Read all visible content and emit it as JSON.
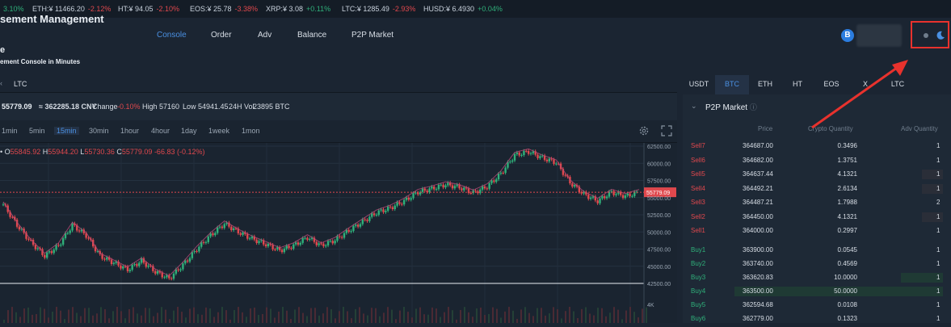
{
  "ticker": [
    {
      "name": "",
      "price": "",
      "change": "3.10%",
      "dir": "up"
    },
    {
      "name": "ETH:",
      "price": "¥ 11466.20",
      "change": "-2.12%",
      "dir": "down"
    },
    {
      "name": "HT:",
      "price": "¥ 94.05",
      "change": "-2.10%",
      "dir": "down"
    },
    {
      "name": "EOS:",
      "price": "¥ 25.78",
      "change": "-3.38%",
      "dir": "down"
    },
    {
      "name": "XRP:",
      "price": "¥ 3.08",
      "change": "+0.11%",
      "dir": "up"
    },
    {
      "name": "LTC:",
      "price": "¥ 1285.49",
      "change": "-2.93%",
      "dir": "down"
    },
    {
      "name": "HUSD:",
      "price": "¥ 6.4930",
      "change": "+0.04%",
      "dir": "up"
    }
  ],
  "header": {
    "title": "sement Management",
    "nav": [
      "Console",
      "Order",
      "Adv",
      "Balance",
      "P2P Market"
    ],
    "avatar": "B",
    "subtitle": "e",
    "subtext": "ement Console in Minutes"
  },
  "colors": {
    "accent": "#4a90e2",
    "up": "#2fb07a",
    "down": "#e0484d",
    "highlight": "#e8322d"
  },
  "left": {
    "coin": "LTC",
    "price": "55779.09",
    "cny": "≈ 362285.18 CNY",
    "change_label": "Change",
    "change_value": "-0.10%",
    "high_label": "High",
    "high_value": "57160",
    "low_label": "Low",
    "low_value": "54941.45",
    "vol_label": "24H Vol.",
    "vol_value": "23895 BTC",
    "intervals": [
      "1min",
      "5min",
      "15min",
      "30min",
      "1hour",
      "4hour",
      "1day",
      "1week",
      "1mon"
    ],
    "active_interval": "15min"
  },
  "chart_data": {
    "type": "line",
    "ohlc": {
      "o": "O",
      "o_val": "55845.92",
      "h": "H",
      "h_val": "55944.20",
      "l": "L",
      "l_val": "55730.36",
      "c": "C",
      "c_val": "55779.09",
      "chg": "-66.83 (-0.12%)"
    },
    "y_ticks": [
      "62500.00",
      "60000.00",
      "57500.00",
      "55000.00",
      "52500.00",
      "50000.00",
      "47500.00",
      "45000.00",
      "42500.00"
    ],
    "y_values": [
      62500,
      60000,
      57500,
      55000,
      52500,
      50000,
      47500,
      45000,
      42500
    ],
    "current_price_label": "55779.09",
    "current_price": 55779.09,
    "volume_tick": "4K",
    "ylim": [
      42500,
      62500
    ],
    "series": [
      {
        "values": [
          54000,
          51000,
          48500,
          46500,
          48000,
          51000,
          49500,
          46500,
          45500,
          44500,
          45800,
          44200,
          43200,
          45200,
          47500,
          49500,
          51200,
          50000,
          49000,
          48200,
          47300,
          48000,
          49200,
          48000,
          48800,
          50200,
          51500,
          52800,
          53500,
          54500,
          55800,
          56300,
          56900,
          56500,
          55700,
          56600,
          58500,
          61200,
          61700,
          60800,
          60100,
          57200,
          55500,
          54500,
          55800,
          55200,
          55779
        ]
      }
    ]
  },
  "right": {
    "tabs": [
      "USDT",
      "BTC",
      "ETH",
      "HT",
      "EOS",
      "X",
      "LTC"
    ],
    "active_tab": "BTC",
    "title": "P2P Market",
    "info_icon": "ⓘ",
    "col_price": "Price",
    "col_crypto": "Crypto Quantity",
    "col_adv": "Adv Quantity",
    "sells": [
      {
        "label": "Sell7",
        "price": "364687.00",
        "qty": "0.3496",
        "adv": "1",
        "depth": 0
      },
      {
        "label": "Sell6",
        "price": "364682.00",
        "qty": "1.3751",
        "adv": "1",
        "depth": 0
      },
      {
        "label": "Sell5",
        "price": "364637.44",
        "qty": "4.1321",
        "adv": "1",
        "depth": 0.1
      },
      {
        "label": "Sell4",
        "price": "364492.21",
        "qty": "2.6134",
        "adv": "1",
        "depth": 0.1
      },
      {
        "label": "Sell3",
        "price": "364487.21",
        "qty": "1.7988",
        "adv": "2",
        "depth": 0
      },
      {
        "label": "Sell2",
        "price": "364450.00",
        "qty": "4.1321",
        "adv": "1",
        "depth": 0.1
      },
      {
        "label": "Sell1",
        "price": "364000.00",
        "qty": "0.2997",
        "adv": "1",
        "depth": 0
      }
    ],
    "buys": [
      {
        "label": "Buy1",
        "price": "363900.00",
        "qty": "0.0545",
        "adv": "1",
        "depth": 0
      },
      {
        "label": "Buy2",
        "price": "363740.00",
        "qty": "0.4569",
        "adv": "1",
        "depth": 0
      },
      {
        "label": "Buy3",
        "price": "363620.83",
        "qty": "10.0000",
        "adv": "1",
        "depth": 0.2
      },
      {
        "label": "Buy4",
        "price": "363500.00",
        "qty": "50.0000",
        "adv": "1",
        "depth": 1
      },
      {
        "label": "Buy5",
        "price": "362594.68",
        "qty": "0.0108",
        "adv": "1",
        "depth": 0
      },
      {
        "label": "Buy6",
        "price": "362779.00",
        "qty": "0.1323",
        "adv": "1",
        "depth": 0
      }
    ]
  }
}
